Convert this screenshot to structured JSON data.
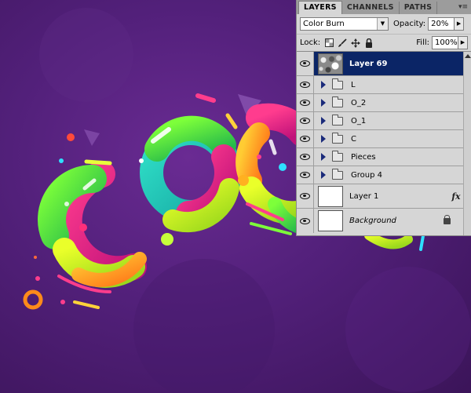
{
  "panel": {
    "tabs": [
      {
        "label": "LAYERS",
        "active": true
      },
      {
        "label": "CHANNELS",
        "active": false
      },
      {
        "label": "PATHS",
        "active": false
      }
    ],
    "blend_mode": "Color Burn",
    "opacity_label": "Opacity:",
    "opacity_value": "20%",
    "lock_label": "Lock:",
    "fill_label": "Fill:",
    "fill_value": "100%",
    "layers": [
      {
        "name": "Layer 69",
        "type": "layer",
        "selected": true
      },
      {
        "name": "L",
        "type": "group"
      },
      {
        "name": "O_2",
        "type": "group"
      },
      {
        "name": "O_1",
        "type": "group"
      },
      {
        "name": "C",
        "type": "group"
      },
      {
        "name": "Pieces",
        "type": "group"
      },
      {
        "name": "Group 4",
        "type": "group"
      },
      {
        "name": "Layer 1",
        "type": "layer",
        "fx": true
      },
      {
        "name": "Background",
        "type": "background",
        "locked": true
      }
    ],
    "fx_symbol": "fx"
  },
  "colors": {
    "canvas_bg": "#52207a",
    "selected_layer": "#0b2566",
    "panel_bg": "#d6d6d6"
  },
  "icons": [
    "eye-icon",
    "folder-icon",
    "expand-arrow-icon",
    "lock-icon",
    "move-icon",
    "brush-icon",
    "transparency-lock-icon",
    "fx-icon",
    "panel-menu-icon"
  ]
}
